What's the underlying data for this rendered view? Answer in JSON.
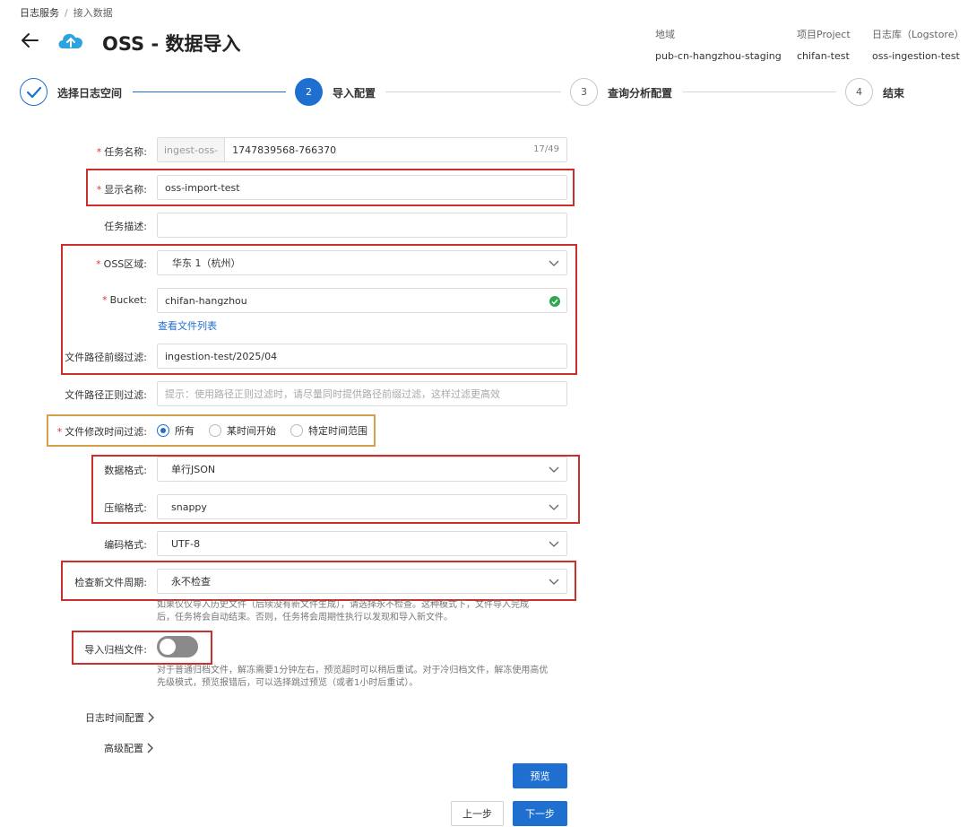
{
  "breadcrumb": {
    "root": "日志服务",
    "separator": "/",
    "current": "接入数据"
  },
  "header": {
    "title": "OSS - 数据导入",
    "logo_icon": "oss-cloud-icon",
    "back_icon": "back-arrow-icon"
  },
  "meta": [
    {
      "key": "地域",
      "value": "pub-cn-hangzhou-staging"
    },
    {
      "key": "项目Project",
      "value": "chifan-test"
    },
    {
      "key": "日志库（Logstore）",
      "value": "oss-ingestion-test"
    }
  ],
  "steps": [
    {
      "number": "",
      "label": "选择日志空间",
      "state": "done"
    },
    {
      "number": "2",
      "label": "导入配置",
      "state": "active"
    },
    {
      "number": "3",
      "label": "查询分析配置",
      "state": "todo"
    },
    {
      "number": "4",
      "label": "结束",
      "state": "todo"
    }
  ],
  "form": {
    "task_name": {
      "label": "任务名称:",
      "prefix": "ingest-oss-",
      "value": "1747839568-766370",
      "counter": "17/49"
    },
    "display_name": {
      "label": "显示名称:",
      "value": "oss-import-test"
    },
    "task_desc": {
      "label": "任务描述:",
      "value": ""
    },
    "oss_region": {
      "label": "OSS区域:",
      "value": "华东 1（杭州）"
    },
    "bucket": {
      "label": "Bucket:",
      "value": "chifan-hangzhou",
      "link": "查看文件列表"
    },
    "path_prefix": {
      "label": "文件路径前缀过滤:",
      "value": "ingestion-test/2025/04"
    },
    "path_regex": {
      "label": "文件路径正则过滤:",
      "placeholder": "提示：使用路径正则过滤时，请尽量同时提供路径前缀过滤，这样过滤更高效"
    },
    "mtime_filter": {
      "label": "文件修改时间过滤:",
      "options": [
        "所有",
        "某时间开始",
        "特定时间范围"
      ],
      "selected": "所有"
    },
    "data_format": {
      "label": "数据格式:",
      "value": "单行JSON"
    },
    "compression": {
      "label": "压缩格式:",
      "value": "snappy"
    },
    "encoding": {
      "label": "编码格式:",
      "value": "UTF-8"
    },
    "check_period": {
      "label": "检查新文件周期:",
      "value": "永不检查",
      "help_line1": "如果仅仅导入历史文件（后续没有新文件生成），请选择永不检查。这种模式下，文件导入完成",
      "help_line2": "后，任务将会自动结束。否则，任务将会周期性执行以发现和导入新文件。"
    },
    "archive": {
      "label": "导入归档文件:",
      "enabled": false,
      "help_line1": "对于普通归档文件，解冻需要1分钟左右，预览超时可以稍后重试。对于冷归档文件，解冻使用高优",
      "help_line2": "先级模式，预览报错后，可以选择跳过预览（或者1小时后重试）。"
    },
    "log_time_config": "日志时间配置",
    "advanced_config": "高级配置"
  },
  "buttons": {
    "preview": "预览",
    "prev": "上一步",
    "next": "下一步"
  },
  "colors": {
    "primary": "#1f6fd0",
    "highlight_red": "#c9302c",
    "highlight_orange": "#d6a04a",
    "success": "#2fa84f"
  }
}
